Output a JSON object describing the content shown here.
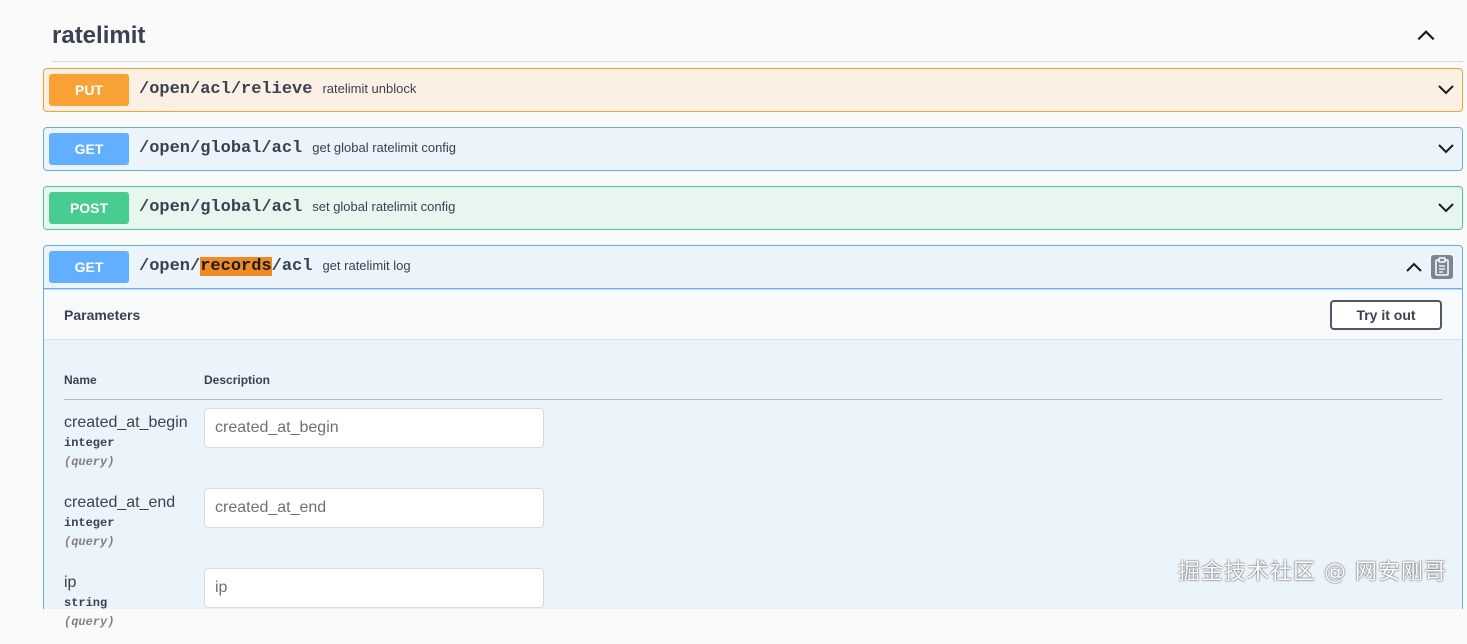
{
  "section": {
    "title": "ratelimit",
    "toggle_icon": "chevron-up-icon"
  },
  "colors": {
    "put": "#f8a236",
    "get": "#61affe",
    "post": "#49cc90",
    "highlight": "#f08a24"
  },
  "operations": [
    {
      "method": "PUT",
      "path": "/open/acl/relieve",
      "description": "ratelimit unblock",
      "expanded": false
    },
    {
      "method": "GET",
      "path": "/open/global/acl",
      "description": "get global ratelimit config",
      "expanded": false
    },
    {
      "method": "POST",
      "path": "/open/global/acl",
      "description": "set global ratelimit config",
      "expanded": false
    },
    {
      "method": "GET",
      "path_prefix": "/open/",
      "path_highlight": "records",
      "path_suffix": "/acl",
      "description": "get ratelimit log",
      "expanded": true,
      "copy_icon": "clipboard-icon"
    }
  ],
  "parameters_panel": {
    "title": "Parameters",
    "try_button_label": "Try it out",
    "columns": {
      "name": "Name",
      "description": "Description"
    },
    "params": [
      {
        "name": "created_at_begin",
        "type": "integer",
        "in": "(query)",
        "placeholder": "created_at_begin"
      },
      {
        "name": "created_at_end",
        "type": "integer",
        "in": "(query)",
        "placeholder": "created_at_end"
      },
      {
        "name": "ip",
        "type": "string",
        "in": "(query)",
        "placeholder": "ip"
      }
    ]
  },
  "watermark": "掘金技术社区 @ 网安刚哥"
}
